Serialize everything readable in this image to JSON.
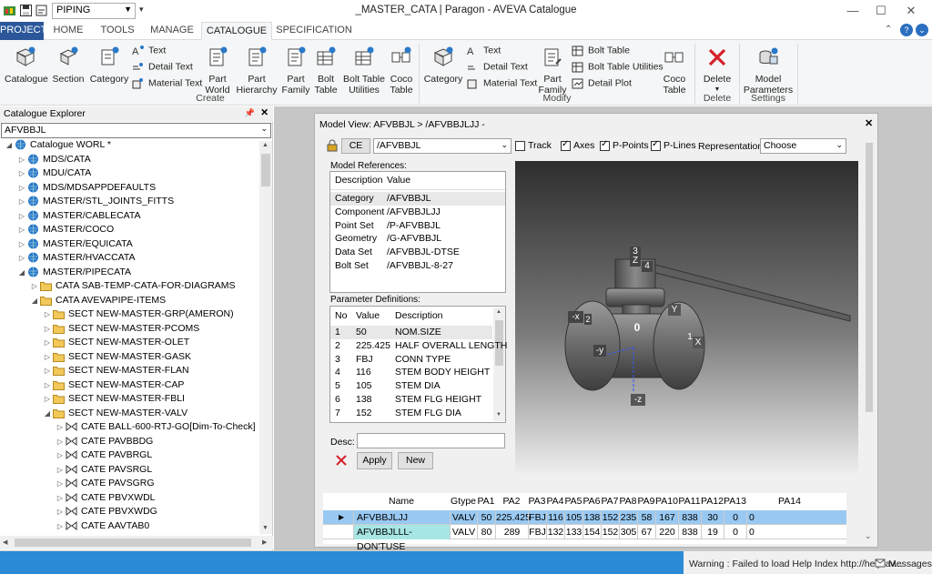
{
  "window": {
    "title": "_MASTER_CATA | Paragon - AVEVA Catalogue",
    "module_combo": "PIPING"
  },
  "tabs": [
    "PROJECT",
    "HOME",
    "TOOLS",
    "MANAGE",
    "CATALOGUE",
    "SPECIFICATION"
  ],
  "ribbon": {
    "create": {
      "label": "Create",
      "big": [
        {
          "l1": "Catalogue",
          "l2": ""
        },
        {
          "l1": "Section",
          "l2": ""
        },
        {
          "l1": "Category",
          "l2": ""
        },
        {
          "l1": "Part",
          "l2": "World"
        },
        {
          "l1": "Part",
          "l2": "Hierarchy"
        },
        {
          "l1": "Part",
          "l2": "Family"
        },
        {
          "l1": "Bolt",
          "l2": "Table"
        },
        {
          "l1": "Bolt Table",
          "l2": "Utilities"
        },
        {
          "l1": "Coco",
          "l2": "Table"
        }
      ],
      "small": [
        "Text",
        "Detail Text",
        "Material Text"
      ]
    },
    "modify": {
      "label": "Modify",
      "category": "Category",
      "small": [
        "Text",
        "Detail Text",
        "Material Text"
      ],
      "part_family": {
        "l1": "Part",
        "l2": "Family"
      },
      "small2": [
        "Bolt Table",
        "Bolt Table Utilities",
        "Detail Plot"
      ],
      "coco": {
        "l1": "Coco",
        "l2": "Table"
      }
    },
    "delete": {
      "label": "Delete",
      "button": "Delete"
    },
    "settings": {
      "label": "Settings",
      "l1": "Model",
      "l2": "Parameters"
    }
  },
  "explorer": {
    "title": "Catalogue Explorer",
    "search_value": "AFVBBJL",
    "nodes": [
      {
        "text": "Catalogue WORL *",
        "indent": 0,
        "exp": "open",
        "icon": "globe"
      },
      {
        "text": "MDS/CATA",
        "indent": 1,
        "exp": "closed",
        "icon": "globe"
      },
      {
        "text": "MDU/CATA",
        "indent": 1,
        "exp": "closed",
        "icon": "globe"
      },
      {
        "text": "MDS/MDSAPPDEFAULTS",
        "indent": 1,
        "exp": "closed",
        "icon": "globe"
      },
      {
        "text": "MASTER/STL_JOINTS_FITTS",
        "indent": 1,
        "exp": "closed",
        "icon": "globe"
      },
      {
        "text": "MASTER/CABLECATA",
        "indent": 1,
        "exp": "closed",
        "icon": "globe"
      },
      {
        "text": "MASTER/COCO",
        "indent": 1,
        "exp": "closed",
        "icon": "globe"
      },
      {
        "text": "MASTER/EQUICATA",
        "indent": 1,
        "exp": "closed",
        "icon": "globe"
      },
      {
        "text": "MASTER/HVACCATA",
        "indent": 1,
        "exp": "closed",
        "icon": "globe"
      },
      {
        "text": "MASTER/PIPECATA",
        "indent": 1,
        "exp": "open",
        "icon": "globe"
      },
      {
        "text": "CATA SAB-TEMP-CATA-FOR-DIAGRAMS",
        "indent": 2,
        "exp": "closed",
        "icon": "folder"
      },
      {
        "text": "CATA AVEVAPIPE-ITEMS",
        "indent": 2,
        "exp": "open",
        "icon": "folder"
      },
      {
        "text": "SECT NEW-MASTER-GRP(AMERON)",
        "indent": 3,
        "exp": "closed",
        "icon": "folder"
      },
      {
        "text": "SECT NEW-MASTER-PCOMS",
        "indent": 3,
        "exp": "closed",
        "icon": "folder"
      },
      {
        "text": "SECT NEW-MASTER-OLET",
        "indent": 3,
        "exp": "closed",
        "icon": "folder"
      },
      {
        "text": "SECT NEW-MASTER-GASK",
        "indent": 3,
        "exp": "closed",
        "icon": "folder"
      },
      {
        "text": "SECT NEW-MASTER-FLAN",
        "indent": 3,
        "exp": "closed",
        "icon": "folder"
      },
      {
        "text": "SECT NEW-MASTER-CAP",
        "indent": 3,
        "exp": "closed",
        "icon": "folder"
      },
      {
        "text": "SECT NEW-MASTER-FBLI",
        "indent": 3,
        "exp": "closed",
        "icon": "folder"
      },
      {
        "text": "SECT NEW-MASTER-VALV",
        "indent": 3,
        "exp": "open",
        "icon": "folder"
      },
      {
        "text": "CATE BALL-600-RTJ-GO[Dim-To-Check]",
        "indent": 4,
        "exp": "closed",
        "icon": "valve"
      },
      {
        "text": "CATE PAVBBDG",
        "indent": 4,
        "exp": "closed",
        "icon": "valve"
      },
      {
        "text": "CATE PAVBRGL",
        "indent": 4,
        "exp": "closed",
        "icon": "valve"
      },
      {
        "text": "CATE PAVSRGL",
        "indent": 4,
        "exp": "closed",
        "icon": "valve"
      },
      {
        "text": "CATE PAVSGRG",
        "indent": 4,
        "exp": "closed",
        "icon": "valve"
      },
      {
        "text": "CATE PBVXWDL",
        "indent": 4,
        "exp": "closed",
        "icon": "valve"
      },
      {
        "text": "CATE PBVXWDG",
        "indent": 4,
        "exp": "closed",
        "icon": "valve"
      },
      {
        "text": "CATE AAVTAB0",
        "indent": 4,
        "exp": "closed",
        "icon": "valve"
      }
    ]
  },
  "model_view": {
    "title": "Model View: AFVBBJL > /AFVBBJLJJ -",
    "ce_label": "CE",
    "ce_value": "/AFVBBJL",
    "checks": [
      {
        "label": "Track",
        "on": false
      },
      {
        "label": "Axes",
        "on": true
      },
      {
        "label": "P-Points",
        "on": true
      },
      {
        "label": "P-Lines",
        "on": true
      }
    ],
    "representation_label": "Representation",
    "representation_value": "Choose",
    "refs_label": "Model References:",
    "refs_headers": [
      "Description",
      "Value"
    ],
    "refs": [
      [
        "Category",
        "/AFVBBJL"
      ],
      [
        "Component",
        "/AFVBBJLJJ"
      ],
      [
        "Point Set",
        "/P-AFVBBJL"
      ],
      [
        "Geometry",
        "/G-AFVBBJL"
      ],
      [
        "Data Set",
        "/AFVBBJL-DTSE"
      ],
      [
        "Bolt Set",
        "/AFVBBJL-8-27"
      ]
    ],
    "params_label": "Parameter Definitions:",
    "params_headers": [
      "No",
      "Value",
      "Description"
    ],
    "params": [
      [
        "1",
        "50",
        "NOM.SIZE"
      ],
      [
        "2",
        "225.425",
        "HALF OVERALL LENGTH"
      ],
      [
        "3",
        "FBJ",
        "CONN TYPE"
      ],
      [
        "4",
        "116",
        "STEM BODY HEIGHT"
      ],
      [
        "5",
        "105",
        "STEM DIA"
      ],
      [
        "6",
        "138",
        "STEM FLG HEIGHT"
      ],
      [
        "7",
        "152",
        "STEM FLG DIA"
      ]
    ],
    "desc_label": "Desc:",
    "desc_value": "",
    "apply": "Apply",
    "new": "New",
    "axis_labels": {
      "z": "Z",
      "three": "3",
      "four": "4",
      "y": "Y",
      "x": "X",
      "one": "1",
      "mx": "-x",
      "my": "-y",
      "mz": "-z",
      "zero": "0",
      "two": "2"
    }
  },
  "grid": {
    "headers": [
      "Name",
      "Gtype",
      "PA1",
      "PA2",
      "PA3",
      "PA4",
      "PA5",
      "PA6",
      "PA7",
      "PA8",
      "PA9",
      "PA10",
      "PA11",
      "PA12",
      "PA13",
      "PA14"
    ],
    "rows": [
      [
        "AFVBBJLJJ",
        "VALV",
        "50",
        "225.425",
        "FBJ",
        "116",
        "105",
        "138",
        "152",
        "235",
        "58",
        "167",
        "838",
        "30",
        "0",
        "0"
      ],
      [
        "AFVBBJLLL-DON'TUSE",
        "VALV",
        "80",
        "289",
        "FBJ",
        "132",
        "133",
        "154",
        "152",
        "305",
        "67",
        "220",
        "838",
        "19",
        "0",
        "0"
      ]
    ]
  },
  "status": {
    "warning": "Warning : Failed to load Help Index http://help.av...",
    "messages": "Messages"
  }
}
